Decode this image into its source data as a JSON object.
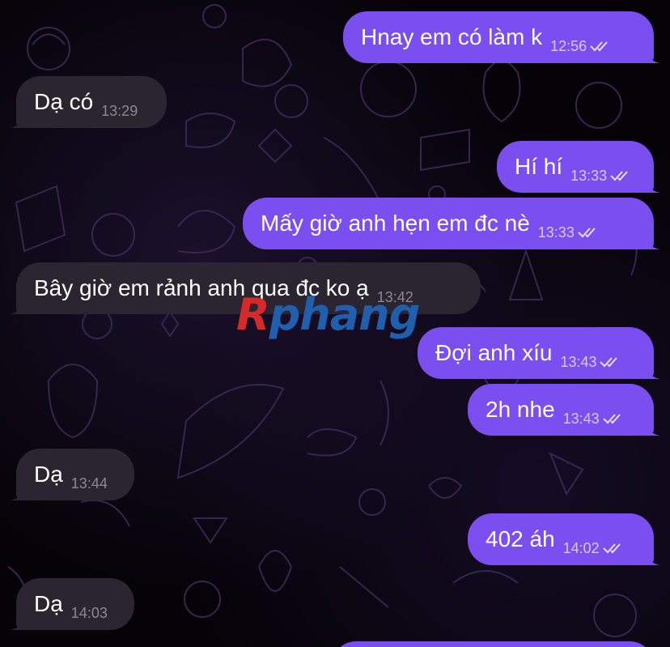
{
  "colors": {
    "outgoing_bubble": "#7b4ef0",
    "incoming_bubble": "#2a2530",
    "background": "#050308",
    "watermark_red": "#d42a2a",
    "watermark_blue": "#1f5fae"
  },
  "messages": [
    {
      "direction": "out",
      "text": "Hnay em có làm k",
      "time": "12:56",
      "status": "read-double-check-icon"
    },
    {
      "direction": "in",
      "text": "Dạ có",
      "time": "13:29"
    },
    {
      "direction": "out",
      "text": "Hí hí",
      "time": "13:33",
      "status": "read-double-check-icon"
    },
    {
      "direction": "out",
      "text": "Mấy giờ anh hẹn em đc nè",
      "time": "13:33",
      "status": "read-double-check-icon"
    },
    {
      "direction": "in",
      "text": "Bây giờ em rảnh anh qua đc ko ạ",
      "time": "13:42"
    },
    {
      "direction": "out",
      "text": "Đợi anh xíu",
      "time": "13:43",
      "status": "read-double-check-icon"
    },
    {
      "direction": "out",
      "text": "2h nhe",
      "time": "13:43",
      "status": "read-double-check-icon"
    },
    {
      "direction": "in",
      "text": "Dạ",
      "time": "13:44"
    },
    {
      "direction": "out",
      "text": "402 áh",
      "time": "14:02",
      "status": "read-double-check-icon"
    },
    {
      "direction": "in",
      "text": "Dạ",
      "time": "14:03"
    }
  ],
  "watermark": {
    "first_letter": "R",
    "rest": "phang"
  }
}
